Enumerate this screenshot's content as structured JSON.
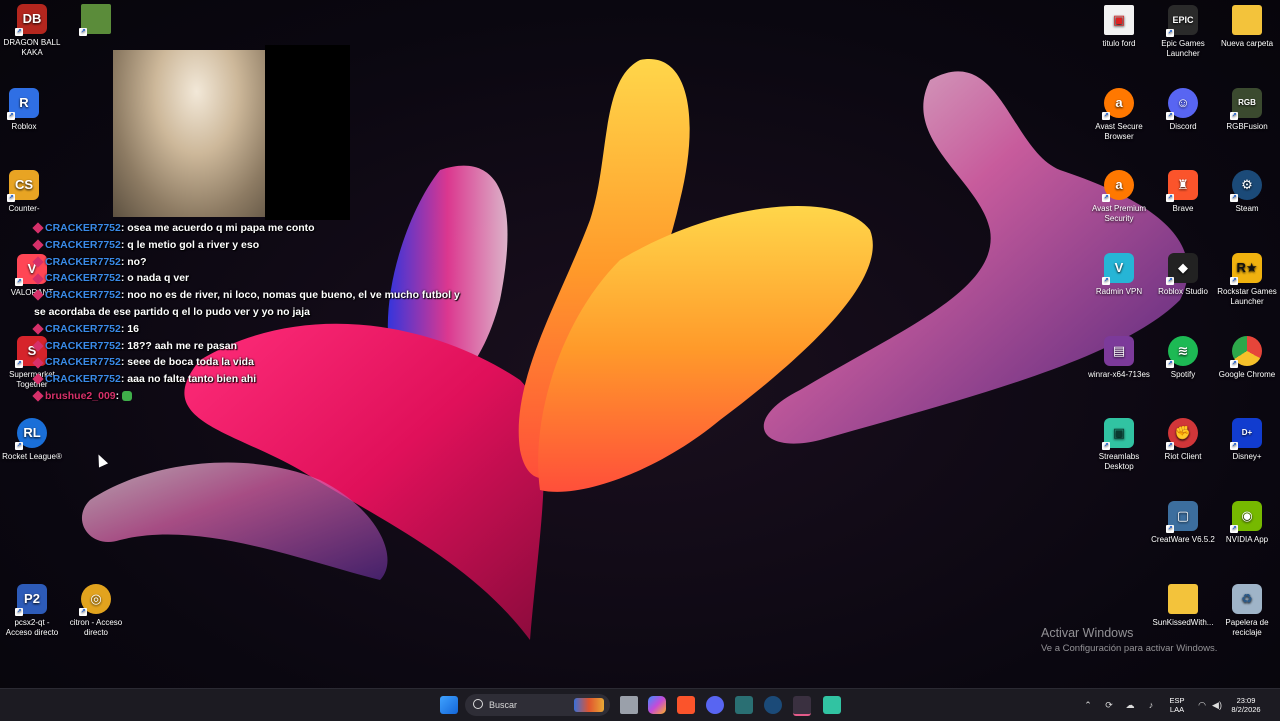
{
  "desktop": {
    "left_icons": [
      {
        "label": "DRAGON BALL\nKAKA",
        "icon": "dragonball-icon",
        "color": "#b3261e"
      },
      {
        "label": "",
        "icon": "minecraft-icon",
        "color": "#5b8c3a"
      },
      {
        "label": "Roblox",
        "icon": "roblox-icon",
        "color": "#2f6fe4"
      },
      {
        "label": "Counter-",
        "icon": "counter-strike-icon",
        "color": "#e8a423"
      },
      {
        "label": "VALORANT",
        "icon": "valorant-icon",
        "color": "#ff4655"
      },
      {
        "label": "Supermarket\nTogether",
        "icon": "supermarket-icon",
        "color": "#d6242b"
      },
      {
        "label": "Rocket League®",
        "icon": "rocket-league-icon",
        "color": "#1a6fd8"
      },
      {
        "label": "pcsx2-qt -\nAcceso directo",
        "icon": "pcsx2-icon",
        "color": "#2d5bb8"
      },
      {
        "label": "citron - Acceso\ndirecto",
        "icon": "citron-icon",
        "color": "#e2a31e"
      }
    ],
    "right_icons": [
      {
        "label": "titulo ford",
        "icon": "pdf-icon",
        "color": "#f2f2f2"
      },
      {
        "label": "Epic Games\nLauncher",
        "icon": "epic-games-icon",
        "color": "#2a2a2a"
      },
      {
        "label": "Nueva carpeta",
        "icon": "folder-icon",
        "color": "#f3c33b"
      },
      {
        "label": "Avast Secure\nBrowser",
        "icon": "avast-browser-icon",
        "color": "#ff7800"
      },
      {
        "label": "Discord",
        "icon": "discord-icon",
        "color": "#5865f2"
      },
      {
        "label": "RGBFusion",
        "icon": "rgbfusion-icon",
        "color": "#3b4a2f"
      },
      {
        "label": "Avast Premium\nSecurity",
        "icon": "avast-security-icon",
        "color": "#ff7800"
      },
      {
        "label": "Brave",
        "icon": "brave-icon",
        "color": "#fb542b"
      },
      {
        "label": "Steam",
        "icon": "steam-icon",
        "color": "#1b4a78"
      },
      {
        "label": "Radmin VPN",
        "icon": "radmin-vpn-icon",
        "color": "#26b5d6"
      },
      {
        "label": "Roblox Studio",
        "icon": "roblox-studio-icon",
        "color": "#222"
      },
      {
        "label": "Rockstar Games\nLauncher",
        "icon": "rockstar-icon",
        "color": "#f0b20f"
      },
      {
        "label": "winrar-x64-713es",
        "icon": "winrar-icon",
        "color": "#7c3a9a"
      },
      {
        "label": "Spotify",
        "icon": "spotify-icon",
        "color": "#1db954"
      },
      {
        "label": "Google Chrome",
        "icon": "chrome-icon",
        "color": "#e6453a"
      },
      {
        "label": "Streamlabs\nDesktop",
        "icon": "streamlabs-icon",
        "color": "#31c3a2"
      },
      {
        "label": "Riot Client",
        "icon": "riot-client-icon",
        "color": "#d13639"
      },
      {
        "label": "Disney+",
        "icon": "disney-plus-icon",
        "color": "#113ccf"
      },
      {
        "label": "CreatWare V6.5.2",
        "icon": "creatware-icon",
        "color": "#3c6e9e"
      },
      {
        "label": "NVIDIA App",
        "icon": "nvidia-icon",
        "color": "#76b900"
      },
      {
        "label": "SunKissedWith...",
        "icon": "folder-icon",
        "color": "#f3c33b"
      },
      {
        "label": "Papelera de\nreciclaje",
        "icon": "recycle-bin-icon",
        "color": "#9fb4c8"
      }
    ]
  },
  "chat": [
    {
      "user": "CRACKER7752",
      "text": ": osea me acuerdo q mi papa me conto"
    },
    {
      "user": "CRACKER7752",
      "text": ": q le metio gol a river y eso"
    },
    {
      "user": "CRACKER7752",
      "text": ": no?"
    },
    {
      "user": "CRACKER7752",
      "text": ": o nada q ver"
    },
    {
      "user": "CRACKER7752",
      "text": ": noo no es de river, ni loco, nomas que bueno, el ve mucho futbol y se acordaba de ese partido q el lo pudo ver y yo no jaja"
    },
    {
      "user": "CRACKER7752",
      "text": ": 16"
    },
    {
      "user": "CRACKER7752",
      "text": ": 18?? aah me re pasan"
    },
    {
      "user": "CRACKER7752",
      "text": ": seee de boca toda la vida"
    },
    {
      "user": "CRACKER7752",
      "text": ": aaa no falta tanto bien ahi"
    },
    {
      "user": "brushue2_009",
      "text": ":"
    }
  ],
  "watermark": {
    "title": "Activar Windows",
    "subtitle": "Ve a Configuración para activar Windows."
  },
  "taskbar": {
    "search_placeholder": "Buscar",
    "language_top": "ESP",
    "language_bottom": "LAA",
    "time": "23:09",
    "date": "8/2/2026"
  }
}
